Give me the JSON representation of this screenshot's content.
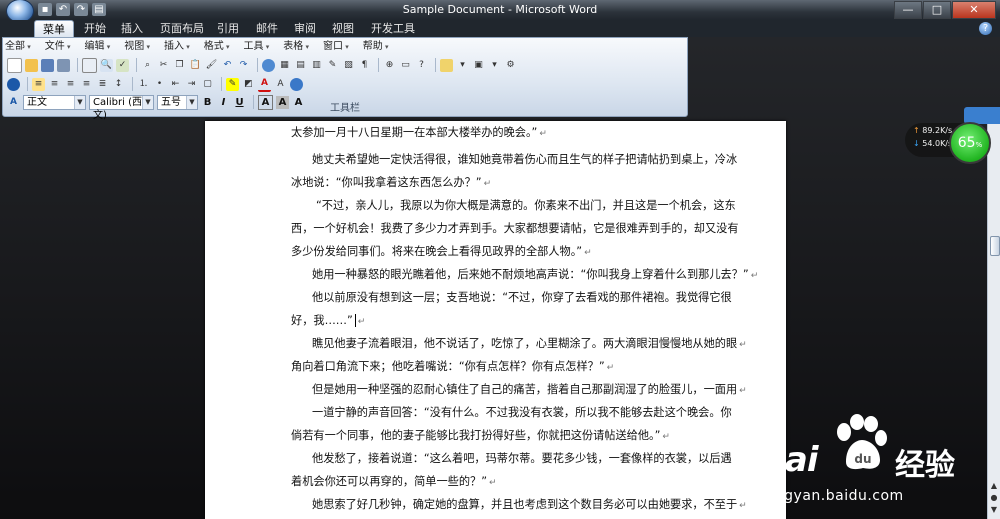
{
  "window": {
    "title": "Sample Document - Microsoft Word",
    "quick_access": [
      "save-icon",
      "undo-icon",
      "redo-icon",
      "print-icon"
    ],
    "controls": {
      "minimize": "—",
      "maximize": "□",
      "close": "✕"
    }
  },
  "ribbon_tabs": [
    "菜单",
    "开始",
    "插入",
    "页面布局",
    "引用",
    "邮件",
    "审阅",
    "视图",
    "开发工具"
  ],
  "active_tab": "菜单",
  "classic_menu": [
    "全部",
    "文件",
    "编辑",
    "视图",
    "插入",
    "格式",
    "工具",
    "表格",
    "窗口",
    "帮助"
  ],
  "format_bar": {
    "style": "正文",
    "font": "Calibri (西文)",
    "size": "五号",
    "buttons": [
      "B",
      "I",
      "U",
      "A",
      "A",
      "A"
    ]
  },
  "ribbon_group_label": "工具栏",
  "document": {
    "lines": [
      "太参加一月十八日星期一在本部大楼举办的晚会。”",
      "她丈夫希望她一定快活得很，谁知她竟带着伤心而且生气的样子把请帖扔到桌上，冷冰",
      "冰地说：“你叫我拿着这东西怎么办？”",
      "“不过，亲人儿，我原以为你大概是满意的。你素来不出门，并且这是一个机会，这东",
      "西，一个好机会！我费了多少力才弄到手。大家都想要请帖，它是很难弄到手的，却又没有",
      "多少份发给同事们。将来在晚会上看得见政界的全部人物。”",
      "她用一种暴怒的眼光瞧着他，后来她不耐烦地高声说：“你叫我身上穿着什么到那儿去？”",
      "他以前原没有想到这一层；支吾地说：“不过，你穿了去看戏的那件裙袍。我觉得它很",
      "好，我……”",
      "瞧见他妻子流着眼泪，他不说话了，吃惊了，心里糊涂了。两大滴眼泪慢慢地从她的眼",
      "角向着口角流下来；他吃着嘴说：“你有点怎样？你有点怎样？”",
      "但是她用一种坚强的忍耐心镇住了自己的痛苦，揩着自己那副润湿了的脸蛋儿，一面用",
      "一道宁静的声音回答：“没有什么。不过我没有衣裳，所以我不能够去赴这个晚会。你",
      "倘若有一个同事，他的妻子能够比我打扮得好些，你就把这份请帖送给他。”",
      "他发愁了，接着说道：“这么着吧，玛蒂尔蒂。要花多少钱，一套像样的衣裳，以后遇",
      "着机会你还可以再穿的，简单一些的？”",
      "她思索了好几秒钟，确定她的盘算，并且也考虑到这个数目务必可以由她要求，不至于"
    ]
  },
  "net_monitor": {
    "upload": "89.2K/s",
    "download": "54.0K/s",
    "percent": "65",
    "percent_unit": "%"
  },
  "watermark": {
    "brand": "Bai",
    "brand2": "经验",
    "url": "jingyan.baidu.com"
  }
}
